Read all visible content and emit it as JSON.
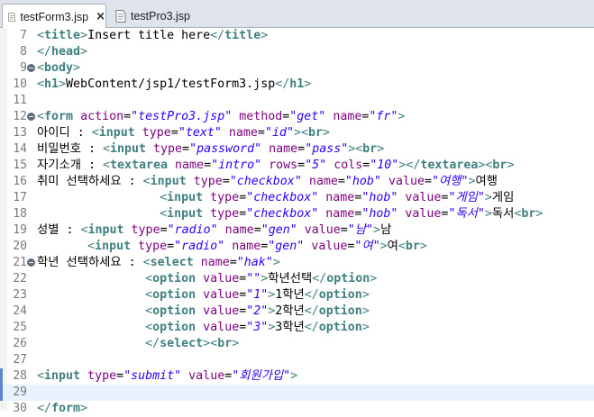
{
  "tabs": [
    {
      "label": "testForm3.jsp",
      "active": true,
      "close_icon": "×"
    },
    {
      "label": "testPro3.jsp",
      "active": false
    }
  ],
  "colors": {
    "tag_bracket": "#3f7f7f",
    "tag_name": "#3f7f7f",
    "attr_name": "#7f007f",
    "attr_value": "#2a00ff",
    "text": "#000000",
    "line_number": "#7a7a7a",
    "current_line": "#e8f2fe"
  },
  "editor": {
    "lines": [
      {
        "n": "7",
        "fold": false,
        "highlight": false,
        "tokens": [
          [
            "t",
            "<"
          ],
          [
            "tn",
            "title"
          ],
          [
            "t",
            ">"
          ],
          [
            "x",
            "Insert title here"
          ],
          [
            "t",
            "</"
          ],
          [
            "tn",
            "title"
          ],
          [
            "t",
            ">"
          ]
        ]
      },
      {
        "n": "8",
        "fold": false,
        "highlight": false,
        "tokens": [
          [
            "t",
            "</"
          ],
          [
            "tn",
            "head"
          ],
          [
            "t",
            ">"
          ]
        ]
      },
      {
        "n": "9",
        "fold": true,
        "highlight": false,
        "tokens": [
          [
            "t",
            "<"
          ],
          [
            "tn",
            "body"
          ],
          [
            "t",
            ">"
          ]
        ]
      },
      {
        "n": "10",
        "fold": false,
        "highlight": false,
        "tokens": [
          [
            "t",
            "<"
          ],
          [
            "tn",
            "h1"
          ],
          [
            "t",
            ">"
          ],
          [
            "x",
            "WebContent/jsp1/testForm3.jsp"
          ],
          [
            "t",
            "</"
          ],
          [
            "tn",
            "h1"
          ],
          [
            "t",
            ">"
          ]
        ]
      },
      {
        "n": "11",
        "fold": false,
        "highlight": false,
        "tokens": []
      },
      {
        "n": "12",
        "fold": true,
        "highlight": false,
        "tokens": [
          [
            "t",
            "<"
          ],
          [
            "tn",
            "form"
          ],
          [
            "x",
            " "
          ],
          [
            "a",
            "action"
          ],
          [
            "x",
            "="
          ],
          [
            "v",
            "\"testPro3.jsp\""
          ],
          [
            "x",
            " "
          ],
          [
            "a",
            "method"
          ],
          [
            "x",
            "="
          ],
          [
            "v",
            "\"get\""
          ],
          [
            "x",
            " "
          ],
          [
            "a",
            "name"
          ],
          [
            "x",
            "="
          ],
          [
            "v",
            "\"fr\""
          ],
          [
            "t",
            ">"
          ]
        ]
      },
      {
        "n": "13",
        "fold": false,
        "highlight": false,
        "tokens": [
          [
            "x",
            "아이디 : "
          ],
          [
            "t",
            "<"
          ],
          [
            "tn",
            "input"
          ],
          [
            "x",
            " "
          ],
          [
            "a",
            "type"
          ],
          [
            "x",
            "="
          ],
          [
            "v",
            "\"text\""
          ],
          [
            "x",
            " "
          ],
          [
            "a",
            "name"
          ],
          [
            "x",
            "="
          ],
          [
            "v",
            "\"id\""
          ],
          [
            "t",
            ">"
          ],
          [
            "t",
            "<"
          ],
          [
            "tn",
            "br"
          ],
          [
            "t",
            ">"
          ]
        ]
      },
      {
        "n": "14",
        "fold": false,
        "highlight": false,
        "tokens": [
          [
            "x",
            "비밀번호 : "
          ],
          [
            "t",
            "<"
          ],
          [
            "tn",
            "input"
          ],
          [
            "x",
            " "
          ],
          [
            "a",
            "type"
          ],
          [
            "x",
            "="
          ],
          [
            "v",
            "\"password\""
          ],
          [
            "x",
            " "
          ],
          [
            "a",
            "name"
          ],
          [
            "x",
            "="
          ],
          [
            "v",
            "\"pass\""
          ],
          [
            "t",
            ">"
          ],
          [
            "t",
            "<"
          ],
          [
            "tn",
            "br"
          ],
          [
            "t",
            ">"
          ]
        ]
      },
      {
        "n": "15",
        "fold": false,
        "highlight": false,
        "tokens": [
          [
            "x",
            "자기소개 : "
          ],
          [
            "t",
            "<"
          ],
          [
            "tn",
            "textarea"
          ],
          [
            "x",
            " "
          ],
          [
            "a",
            "name"
          ],
          [
            "x",
            "="
          ],
          [
            "v",
            "\"intro\""
          ],
          [
            "x",
            " "
          ],
          [
            "a",
            "rows"
          ],
          [
            "x",
            "="
          ],
          [
            "v",
            "\"5\""
          ],
          [
            "x",
            " "
          ],
          [
            "a",
            "cols"
          ],
          [
            "x",
            "="
          ],
          [
            "v",
            "\"10\""
          ],
          [
            "t",
            "></"
          ],
          [
            "tn",
            "textarea"
          ],
          [
            "t",
            ">"
          ],
          [
            "t",
            "<"
          ],
          [
            "tn",
            "br"
          ],
          [
            "t",
            ">"
          ]
        ]
      },
      {
        "n": "16",
        "fold": false,
        "highlight": false,
        "tokens": [
          [
            "x",
            "취미 선택하세요 : "
          ],
          [
            "t",
            "<"
          ],
          [
            "tn",
            "input"
          ],
          [
            "x",
            " "
          ],
          [
            "a",
            "type"
          ],
          [
            "x",
            "="
          ],
          [
            "v",
            "\"checkbox\""
          ],
          [
            "x",
            " "
          ],
          [
            "a",
            "name"
          ],
          [
            "x",
            "="
          ],
          [
            "v",
            "\"hob\""
          ],
          [
            "x",
            " "
          ],
          [
            "a",
            "value"
          ],
          [
            "x",
            "="
          ],
          [
            "v",
            "\"여행\""
          ],
          [
            "t",
            ">"
          ],
          [
            "x",
            "여행"
          ]
        ]
      },
      {
        "n": "17",
        "fold": false,
        "highlight": false,
        "tokens": [
          [
            "x",
            "                 "
          ],
          [
            "t",
            "<"
          ],
          [
            "tn",
            "input"
          ],
          [
            "x",
            " "
          ],
          [
            "a",
            "type"
          ],
          [
            "x",
            "="
          ],
          [
            "v",
            "\"checkbox\""
          ],
          [
            "x",
            " "
          ],
          [
            "a",
            "name"
          ],
          [
            "x",
            "="
          ],
          [
            "v",
            "\"hob\""
          ],
          [
            "x",
            " "
          ],
          [
            "a",
            "value"
          ],
          [
            "x",
            "="
          ],
          [
            "v",
            "\"게임\""
          ],
          [
            "t",
            ">"
          ],
          [
            "x",
            "게임"
          ]
        ]
      },
      {
        "n": "18",
        "fold": false,
        "highlight": false,
        "tokens": [
          [
            "x",
            "                 "
          ],
          [
            "t",
            "<"
          ],
          [
            "tn",
            "input"
          ],
          [
            "x",
            " "
          ],
          [
            "a",
            "type"
          ],
          [
            "x",
            "="
          ],
          [
            "v",
            "\"checkbox\""
          ],
          [
            "x",
            " "
          ],
          [
            "a",
            "name"
          ],
          [
            "x",
            "="
          ],
          [
            "v",
            "\"hob\""
          ],
          [
            "x",
            " "
          ],
          [
            "a",
            "value"
          ],
          [
            "x",
            "="
          ],
          [
            "v",
            "\"독서\""
          ],
          [
            "t",
            ">"
          ],
          [
            "x",
            "독서"
          ],
          [
            "t",
            "<"
          ],
          [
            "tn",
            "br"
          ],
          [
            "t",
            ">"
          ]
        ]
      },
      {
        "n": "19",
        "fold": false,
        "highlight": false,
        "tokens": [
          [
            "x",
            "성별 : "
          ],
          [
            "t",
            "<"
          ],
          [
            "tn",
            "input"
          ],
          [
            "x",
            " "
          ],
          [
            "a",
            "type"
          ],
          [
            "x",
            "="
          ],
          [
            "v",
            "\"radio\""
          ],
          [
            "x",
            " "
          ],
          [
            "a",
            "name"
          ],
          [
            "x",
            "="
          ],
          [
            "v",
            "\"gen\""
          ],
          [
            "x",
            " "
          ],
          [
            "a",
            "value"
          ],
          [
            "x",
            "="
          ],
          [
            "v",
            "\"남\""
          ],
          [
            "t",
            ">"
          ],
          [
            "x",
            "남"
          ]
        ]
      },
      {
        "n": "20",
        "fold": false,
        "highlight": false,
        "tokens": [
          [
            "x",
            "       "
          ],
          [
            "t",
            "<"
          ],
          [
            "tn",
            "input"
          ],
          [
            "x",
            " "
          ],
          [
            "a",
            "type"
          ],
          [
            "x",
            "="
          ],
          [
            "v",
            "\"radio\""
          ],
          [
            "x",
            " "
          ],
          [
            "a",
            "name"
          ],
          [
            "x",
            "="
          ],
          [
            "v",
            "\"gen\""
          ],
          [
            "x",
            " "
          ],
          [
            "a",
            "value"
          ],
          [
            "x",
            "="
          ],
          [
            "v",
            "\"여\""
          ],
          [
            "t",
            ">"
          ],
          [
            "x",
            "여"
          ],
          [
            "t",
            "<"
          ],
          [
            "tn",
            "br"
          ],
          [
            "t",
            ">"
          ]
        ]
      },
      {
        "n": "21",
        "fold": true,
        "highlight": false,
        "tokens": [
          [
            "x",
            "학년 선택하세요 : "
          ],
          [
            "t",
            "<"
          ],
          [
            "tn",
            "select"
          ],
          [
            "x",
            " "
          ],
          [
            "a",
            "name"
          ],
          [
            "x",
            "="
          ],
          [
            "v",
            "\"hak\""
          ],
          [
            "t",
            ">"
          ]
        ]
      },
      {
        "n": "22",
        "fold": false,
        "highlight": false,
        "tokens": [
          [
            "x",
            "               "
          ],
          [
            "t",
            "<"
          ],
          [
            "tn",
            "option"
          ],
          [
            "x",
            " "
          ],
          [
            "a",
            "value"
          ],
          [
            "x",
            "="
          ],
          [
            "v",
            "\"\""
          ],
          [
            "t",
            ">"
          ],
          [
            "x",
            "학년선택"
          ],
          [
            "t",
            "</"
          ],
          [
            "tn",
            "option"
          ],
          [
            "t",
            ">"
          ]
        ]
      },
      {
        "n": "23",
        "fold": false,
        "highlight": false,
        "tokens": [
          [
            "x",
            "               "
          ],
          [
            "t",
            "<"
          ],
          [
            "tn",
            "option"
          ],
          [
            "x",
            " "
          ],
          [
            "a",
            "value"
          ],
          [
            "x",
            "="
          ],
          [
            "v",
            "\"1\""
          ],
          [
            "t",
            ">"
          ],
          [
            "x",
            "1학년"
          ],
          [
            "t",
            "</"
          ],
          [
            "tn",
            "option"
          ],
          [
            "t",
            ">"
          ]
        ]
      },
      {
        "n": "24",
        "fold": false,
        "highlight": false,
        "tokens": [
          [
            "x",
            "               "
          ],
          [
            "t",
            "<"
          ],
          [
            "tn",
            "option"
          ],
          [
            "x",
            " "
          ],
          [
            "a",
            "value"
          ],
          [
            "x",
            "="
          ],
          [
            "v",
            "\"2\""
          ],
          [
            "t",
            ">"
          ],
          [
            "x",
            "2학년"
          ],
          [
            "t",
            "</"
          ],
          [
            "tn",
            "option"
          ],
          [
            "t",
            ">"
          ]
        ]
      },
      {
        "n": "25",
        "fold": false,
        "highlight": false,
        "tokens": [
          [
            "x",
            "               "
          ],
          [
            "t",
            "<"
          ],
          [
            "tn",
            "option"
          ],
          [
            "x",
            " "
          ],
          [
            "a",
            "value"
          ],
          [
            "x",
            "="
          ],
          [
            "v",
            "\"3\""
          ],
          [
            "t",
            ">"
          ],
          [
            "x",
            "3학년"
          ],
          [
            "t",
            "</"
          ],
          [
            "tn",
            "option"
          ],
          [
            "t",
            ">"
          ]
        ]
      },
      {
        "n": "26",
        "fold": false,
        "highlight": false,
        "tokens": [
          [
            "x",
            "               "
          ],
          [
            "t",
            "</"
          ],
          [
            "tn",
            "select"
          ],
          [
            "t",
            ">"
          ],
          [
            "t",
            "<"
          ],
          [
            "tn",
            "br"
          ],
          [
            "t",
            ">"
          ]
        ]
      },
      {
        "n": "27",
        "fold": false,
        "highlight": false,
        "tokens": []
      },
      {
        "n": "28",
        "fold": false,
        "highlight": false,
        "tokens": [
          [
            "t",
            "<"
          ],
          [
            "tn",
            "input"
          ],
          [
            "x",
            " "
          ],
          [
            "a",
            "type"
          ],
          [
            "x",
            "="
          ],
          [
            "v",
            "\"submit\""
          ],
          [
            "x",
            " "
          ],
          [
            "a",
            "value"
          ],
          [
            "x",
            "="
          ],
          [
            "v",
            "\"회원가입\""
          ],
          [
            "t",
            ">"
          ]
        ]
      },
      {
        "n": "29",
        "fold": false,
        "highlight": true,
        "tokens": []
      },
      {
        "n": "30",
        "fold": false,
        "highlight": false,
        "tokens": [
          [
            "t",
            "</"
          ],
          [
            "tn",
            "form"
          ],
          [
            "t",
            ">"
          ]
        ]
      }
    ]
  }
}
